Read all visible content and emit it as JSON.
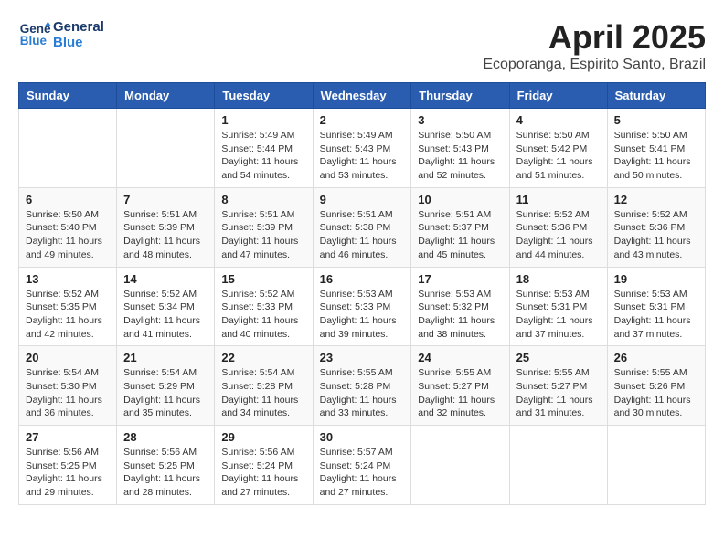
{
  "logo": {
    "line1": "General",
    "line2": "Blue"
  },
  "title": "April 2025",
  "location": "Ecoporanga, Espirito Santo, Brazil",
  "days_of_week": [
    "Sunday",
    "Monday",
    "Tuesday",
    "Wednesday",
    "Thursday",
    "Friday",
    "Saturday"
  ],
  "weeks": [
    [
      {
        "day": "",
        "info": ""
      },
      {
        "day": "",
        "info": ""
      },
      {
        "day": "1",
        "info": "Sunrise: 5:49 AM\nSunset: 5:44 PM\nDaylight: 11 hours and 54 minutes."
      },
      {
        "day": "2",
        "info": "Sunrise: 5:49 AM\nSunset: 5:43 PM\nDaylight: 11 hours and 53 minutes."
      },
      {
        "day": "3",
        "info": "Sunrise: 5:50 AM\nSunset: 5:43 PM\nDaylight: 11 hours and 52 minutes."
      },
      {
        "day": "4",
        "info": "Sunrise: 5:50 AM\nSunset: 5:42 PM\nDaylight: 11 hours and 51 minutes."
      },
      {
        "day": "5",
        "info": "Sunrise: 5:50 AM\nSunset: 5:41 PM\nDaylight: 11 hours and 50 minutes."
      }
    ],
    [
      {
        "day": "6",
        "info": "Sunrise: 5:50 AM\nSunset: 5:40 PM\nDaylight: 11 hours and 49 minutes."
      },
      {
        "day": "7",
        "info": "Sunrise: 5:51 AM\nSunset: 5:39 PM\nDaylight: 11 hours and 48 minutes."
      },
      {
        "day": "8",
        "info": "Sunrise: 5:51 AM\nSunset: 5:39 PM\nDaylight: 11 hours and 47 minutes."
      },
      {
        "day": "9",
        "info": "Sunrise: 5:51 AM\nSunset: 5:38 PM\nDaylight: 11 hours and 46 minutes."
      },
      {
        "day": "10",
        "info": "Sunrise: 5:51 AM\nSunset: 5:37 PM\nDaylight: 11 hours and 45 minutes."
      },
      {
        "day": "11",
        "info": "Sunrise: 5:52 AM\nSunset: 5:36 PM\nDaylight: 11 hours and 44 minutes."
      },
      {
        "day": "12",
        "info": "Sunrise: 5:52 AM\nSunset: 5:36 PM\nDaylight: 11 hours and 43 minutes."
      }
    ],
    [
      {
        "day": "13",
        "info": "Sunrise: 5:52 AM\nSunset: 5:35 PM\nDaylight: 11 hours and 42 minutes."
      },
      {
        "day": "14",
        "info": "Sunrise: 5:52 AM\nSunset: 5:34 PM\nDaylight: 11 hours and 41 minutes."
      },
      {
        "day": "15",
        "info": "Sunrise: 5:52 AM\nSunset: 5:33 PM\nDaylight: 11 hours and 40 minutes."
      },
      {
        "day": "16",
        "info": "Sunrise: 5:53 AM\nSunset: 5:33 PM\nDaylight: 11 hours and 39 minutes."
      },
      {
        "day": "17",
        "info": "Sunrise: 5:53 AM\nSunset: 5:32 PM\nDaylight: 11 hours and 38 minutes."
      },
      {
        "day": "18",
        "info": "Sunrise: 5:53 AM\nSunset: 5:31 PM\nDaylight: 11 hours and 37 minutes."
      },
      {
        "day": "19",
        "info": "Sunrise: 5:53 AM\nSunset: 5:31 PM\nDaylight: 11 hours and 37 minutes."
      }
    ],
    [
      {
        "day": "20",
        "info": "Sunrise: 5:54 AM\nSunset: 5:30 PM\nDaylight: 11 hours and 36 minutes."
      },
      {
        "day": "21",
        "info": "Sunrise: 5:54 AM\nSunset: 5:29 PM\nDaylight: 11 hours and 35 minutes."
      },
      {
        "day": "22",
        "info": "Sunrise: 5:54 AM\nSunset: 5:28 PM\nDaylight: 11 hours and 34 minutes."
      },
      {
        "day": "23",
        "info": "Sunrise: 5:55 AM\nSunset: 5:28 PM\nDaylight: 11 hours and 33 minutes."
      },
      {
        "day": "24",
        "info": "Sunrise: 5:55 AM\nSunset: 5:27 PM\nDaylight: 11 hours and 32 minutes."
      },
      {
        "day": "25",
        "info": "Sunrise: 5:55 AM\nSunset: 5:27 PM\nDaylight: 11 hours and 31 minutes."
      },
      {
        "day": "26",
        "info": "Sunrise: 5:55 AM\nSunset: 5:26 PM\nDaylight: 11 hours and 30 minutes."
      }
    ],
    [
      {
        "day": "27",
        "info": "Sunrise: 5:56 AM\nSunset: 5:25 PM\nDaylight: 11 hours and 29 minutes."
      },
      {
        "day": "28",
        "info": "Sunrise: 5:56 AM\nSunset: 5:25 PM\nDaylight: 11 hours and 28 minutes."
      },
      {
        "day": "29",
        "info": "Sunrise: 5:56 AM\nSunset: 5:24 PM\nDaylight: 11 hours and 27 minutes."
      },
      {
        "day": "30",
        "info": "Sunrise: 5:57 AM\nSunset: 5:24 PM\nDaylight: 11 hours and 27 minutes."
      },
      {
        "day": "",
        "info": ""
      },
      {
        "day": "",
        "info": ""
      },
      {
        "day": "",
        "info": ""
      }
    ]
  ]
}
